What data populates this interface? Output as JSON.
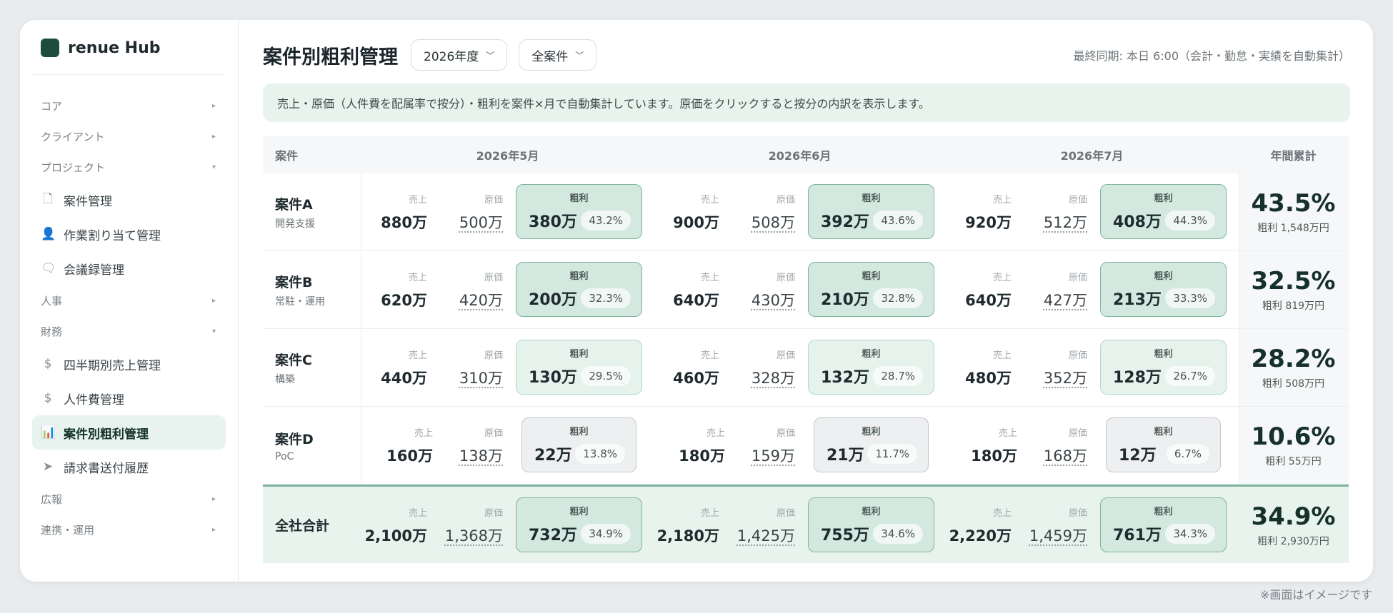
{
  "sidebar": {
    "brand": "renue Hub",
    "groups": [
      {
        "label": "コア",
        "chevron": "▸"
      },
      {
        "label": "クライアント",
        "chevron": "▸"
      },
      {
        "label": "プロジェクト",
        "chevron": "▾",
        "items": [
          {
            "label": "案件管理",
            "icon": "document-icon",
            "glyph": "🗋"
          },
          {
            "label": "作業割り当て管理",
            "icon": "user-icon",
            "glyph": "👤"
          },
          {
            "label": "会議録管理",
            "icon": "chat-icon",
            "glyph": "🗨"
          }
        ]
      },
      {
        "label": "人事",
        "chevron": "▸"
      },
      {
        "label": "財務",
        "chevron": "▾",
        "items": [
          {
            "label": "四半期別売上管理",
            "icon": "dollar-icon",
            "glyph": "$"
          },
          {
            "label": "人件費管理",
            "icon": "dollar-icon",
            "glyph": "$"
          },
          {
            "label": "案件別粗利管理",
            "icon": "bar-chart-icon",
            "glyph": "📊",
            "active": true
          },
          {
            "label": "請求書送付履歴",
            "icon": "send-icon",
            "glyph": "➤"
          }
        ]
      },
      {
        "label": "広報",
        "chevron": "▸"
      },
      {
        "label": "連携・運用",
        "chevron": "▸"
      }
    ]
  },
  "header": {
    "title": "案件別粗利管理",
    "year_filter": "2026年度",
    "case_filter": "全案件",
    "dropdown_chevron": "﹀",
    "sync": "最終同期: 本日 6:00（会計・勤怠・実績を自動集計）"
  },
  "banner": "売上・原価（人件費を配属率で按分）・粗利を案件×月で自動集計しています。原価をクリックすると按分の内訳を表示します。",
  "table": {
    "col_case": "案件",
    "col_year": "年間累計",
    "months": [
      "2026年5月",
      "2026年6月",
      "2026年7月"
    ],
    "labels": {
      "sales": "売上",
      "cost": "原価",
      "gross": "粗利"
    },
    "rows": [
      {
        "name": "案件A",
        "sub": "開発支援",
        "tone": "strong",
        "cells": [
          {
            "sales": "880万",
            "cost": "500万",
            "gross": "380万",
            "pct": "43.2%"
          },
          {
            "sales": "900万",
            "cost": "508万",
            "gross": "392万",
            "pct": "43.6%"
          },
          {
            "sales": "920万",
            "cost": "512万",
            "gross": "408万",
            "pct": "44.3%"
          }
        ],
        "year_pct": "43.5%",
        "year_gross": "粗利 1,548万円"
      },
      {
        "name": "案件B",
        "sub": "常駐・運用",
        "tone": "strong",
        "cells": [
          {
            "sales": "620万",
            "cost": "420万",
            "gross": "200万",
            "pct": "32.3%"
          },
          {
            "sales": "640万",
            "cost": "430万",
            "gross": "210万",
            "pct": "32.8%"
          },
          {
            "sales": "640万",
            "cost": "427万",
            "gross": "213万",
            "pct": "33.3%"
          }
        ],
        "year_pct": "32.5%",
        "year_gross": "粗利 819万円"
      },
      {
        "name": "案件C",
        "sub": "構築",
        "tone": "light",
        "cells": [
          {
            "sales": "440万",
            "cost": "310万",
            "gross": "130万",
            "pct": "29.5%"
          },
          {
            "sales": "460万",
            "cost": "328万",
            "gross": "132万",
            "pct": "28.7%"
          },
          {
            "sales": "480万",
            "cost": "352万",
            "gross": "128万",
            "pct": "26.7%"
          }
        ],
        "year_pct": "28.2%",
        "year_gross": "粗利 508万円"
      },
      {
        "name": "案件D",
        "sub": "PoC",
        "tone": "gray",
        "cells": [
          {
            "sales": "160万",
            "cost": "138万",
            "gross": "22万",
            "pct": "13.8%"
          },
          {
            "sales": "180万",
            "cost": "159万",
            "gross": "21万",
            "pct": "11.7%"
          },
          {
            "sales": "180万",
            "cost": "168万",
            "gross": "12万",
            "pct": "6.7%"
          }
        ],
        "year_pct": "10.6%",
        "year_gross": "粗利 55万円"
      }
    ],
    "total": {
      "name": "全社合計",
      "tone": "strong",
      "cells": [
        {
          "sales": "2,100万",
          "cost": "1,368万",
          "gross": "732万",
          "pct": "34.9%"
        },
        {
          "sales": "2,180万",
          "cost": "1,425万",
          "gross": "755万",
          "pct": "34.6%"
        },
        {
          "sales": "2,220万",
          "cost": "1,459万",
          "gross": "761万",
          "pct": "34.3%"
        }
      ],
      "year_pct": "34.9%",
      "year_gross": "粗利 2,930万円"
    }
  },
  "footnote": "※画面はイメージです"
}
